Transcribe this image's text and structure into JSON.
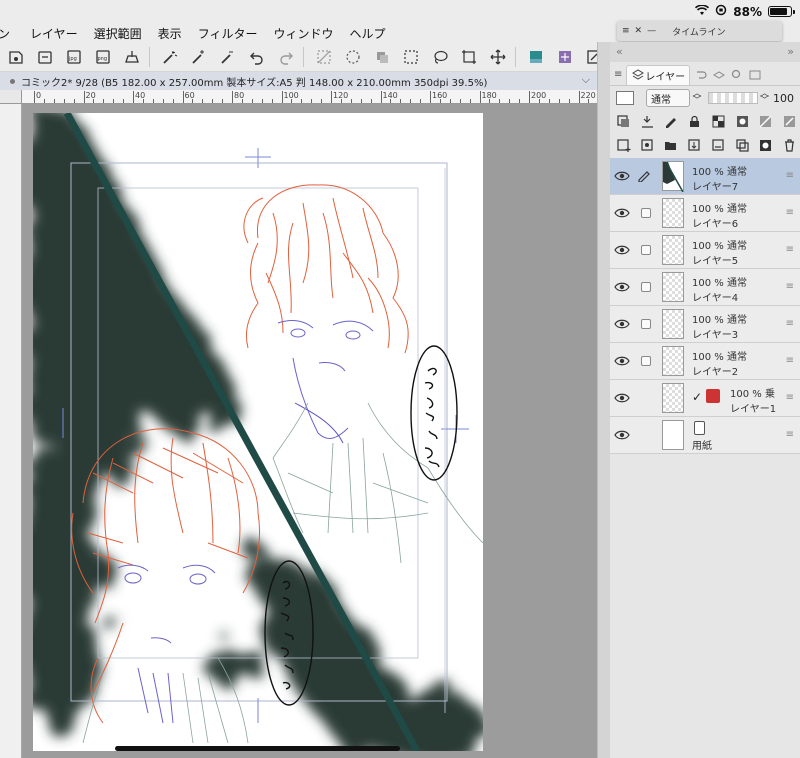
{
  "status": {
    "battery": "88%"
  },
  "menu": [
    "ン",
    "レイヤー",
    "選択範囲",
    "表示",
    "フィルター",
    "ウィンドウ",
    "ヘルプ"
  ],
  "timeline": {
    "title": "タイムライン"
  },
  "toolbar": {
    "items": [
      "save-icon",
      "export-icon",
      "jpg-icon",
      "png-icon",
      "print-icon",
      "wand-icon",
      "wand-add-icon",
      "wand-sub-icon",
      "undo-icon",
      "redo-icon",
      "clear-icon",
      "transform-icon",
      "copy-icon",
      "select-icon",
      "lasso-icon",
      "crop-icon",
      "move-icon",
      "layer-color-icon",
      "layer-effect-icon",
      "layer-settings-icon"
    ]
  },
  "document": {
    "title": "コミック2* 9/28 (B5 182.00 x 257.00mm 製本サイズ:A5 判 148.00 x 210.00mm 350dpi 39.5%)"
  },
  "ruler": {
    "labels": [
      "0",
      "20",
      "40",
      "60",
      "80",
      "100",
      "120",
      "140",
      "160",
      "180",
      "200",
      "220"
    ]
  },
  "panel": {
    "tabs": [
      "レイヤー"
    ],
    "blend_mode": "通常",
    "opacity": "100",
    "layers": [
      {
        "pct": "100 % 通常",
        "name": "レイヤー7",
        "selected": true,
        "icon": "pencil-icon"
      },
      {
        "pct": "100 % 通常",
        "name": "レイヤー6"
      },
      {
        "pct": "100 % 通常",
        "name": "レイヤー5"
      },
      {
        "pct": "100 % 通常",
        "name": "レイヤー4"
      },
      {
        "pct": "100 % 通常",
        "name": "レイヤー3"
      },
      {
        "pct": "100 % 通常",
        "name": "レイヤー2"
      },
      {
        "pct": "100 % 乗",
        "name": "レイヤー1"
      },
      {
        "pct": "",
        "name": "用紙"
      }
    ]
  }
}
